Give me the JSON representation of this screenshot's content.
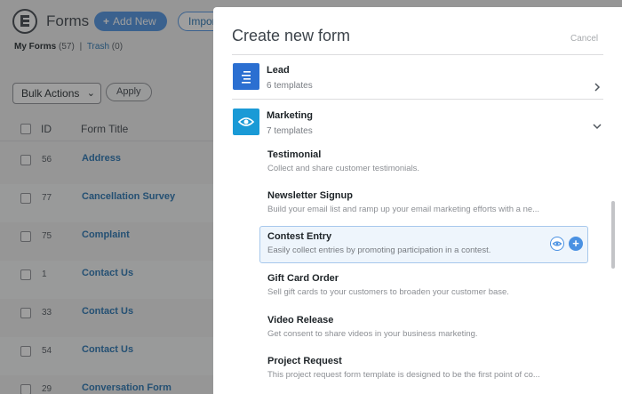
{
  "app": {
    "title": "Forms",
    "add_new_label": "Add New",
    "import_label": "Import"
  },
  "views": {
    "my_forms_label": "My Forms",
    "my_forms_count": "(57)",
    "separator": "|",
    "trash_label": "Trash",
    "trash_count": "(0)"
  },
  "bulk": {
    "selected": "Bulk Actions",
    "apply_label": "Apply"
  },
  "table": {
    "col_id": "ID",
    "col_title": "Form Title",
    "rows": [
      {
        "id": "56",
        "title": "Address"
      },
      {
        "id": "77",
        "title": "Cancellation Survey"
      },
      {
        "id": "75",
        "title": "Complaint"
      },
      {
        "id": "1",
        "title": "Contact Us"
      },
      {
        "id": "33",
        "title": "Contact Us"
      },
      {
        "id": "54",
        "title": "Contact Us"
      },
      {
        "id": "29",
        "title": "Conversation Form"
      }
    ]
  },
  "modal": {
    "title": "Create new form",
    "cancel_label": "Cancel",
    "categories": [
      {
        "name": "Lead",
        "count": "6 templates",
        "icon": "list-icon",
        "color": "#2b6fd1"
      },
      {
        "name": "Marketing",
        "count": "7 templates",
        "icon": "eye-icon",
        "color": "#1a9ad6"
      }
    ],
    "templates": [
      {
        "name": "Testimonial",
        "description": "Collect and share customer testimonials."
      },
      {
        "name": "Newsletter Signup",
        "description": "Build your email list and ramp up your email marketing efforts with a ne..."
      },
      {
        "name": "Contest Entry",
        "description": "Easily collect entries by promoting participation in a contest."
      },
      {
        "name": "Gift Card Order",
        "description": "Sell gift cards to your customers to broaden your customer base."
      },
      {
        "name": "Video Release",
        "description": "Get consent to share videos in your business marketing."
      },
      {
        "name": "Project Request",
        "description": "This project request form template is designed to be the first point of co..."
      }
    ],
    "use_symbol": "+"
  },
  "colors": {
    "accent": "#4a91e2",
    "link": "#2271b1",
    "highlight_bg": "#eef5fc"
  }
}
